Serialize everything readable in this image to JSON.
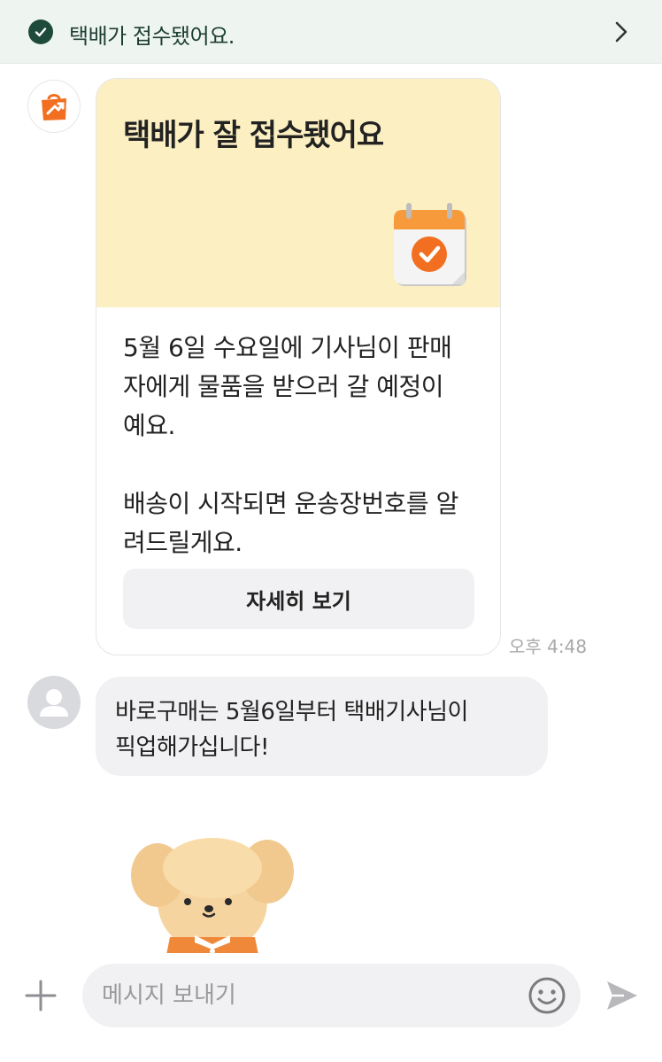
{
  "banner": {
    "text": "택배가 접수됐어요."
  },
  "card": {
    "title": "택배가 잘 접수됐어요",
    "paragraph1_line1": "5월 6일 수요일에 기사님이 판매",
    "paragraph1_line2": "자에게 물품을 받으러 갈 예정이",
    "paragraph1_line3": "예요.",
    "paragraph2_line1": "배송이 시작되면 운송장번호를 알",
    "paragraph2_line2": "려드릴게요.",
    "button_label": "자세히 보기"
  },
  "card_time": "오후 4:48",
  "reply": {
    "line1": "바로구매는 5월6일부터 택배기사님이",
    "line2": "픽업해가십니다!"
  },
  "composer": {
    "placeholder": "메시지 보내기"
  },
  "colors": {
    "accent_green": "#1e4a3c",
    "card_yellow": "#fcefc1",
    "shop_orange": "#f26f21"
  },
  "icons": [
    "check-circle-icon",
    "chevron-right-icon",
    "shop-bag-icon",
    "calendar-check-icon",
    "user-avatar-icon",
    "plus-icon",
    "emoji-icon",
    "send-icon"
  ]
}
